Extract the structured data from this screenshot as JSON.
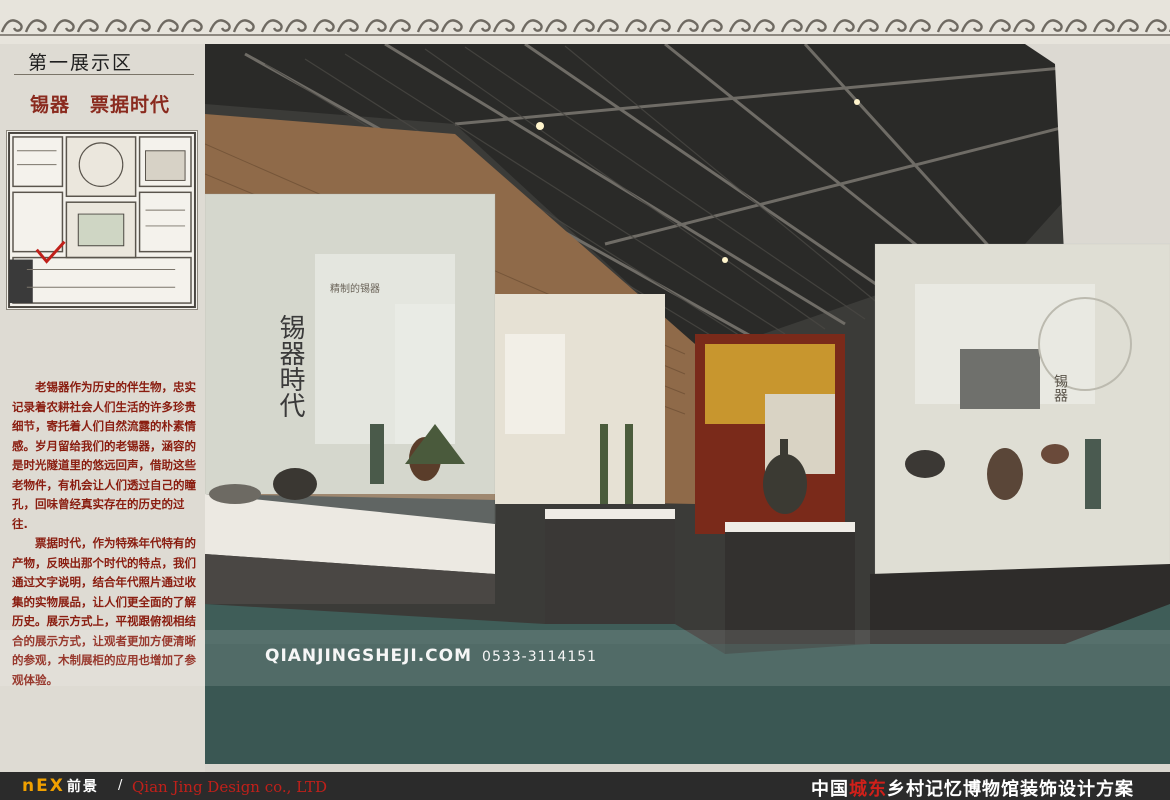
{
  "zone": {
    "title": "第一展示区",
    "subtitle_left": "锡器",
    "subtitle_right": "票据时代"
  },
  "description": {
    "para1": "老锡器作为历史的伴生物，忠实记录着农耕社会人们生活的许多珍贵细节，寄托着人们自然流露的朴素情感。岁月留给我们的老锡器，涵容的是时光隧道里的悠远回声，借助这些老物件，有机会让人们透过自己的瞳孔，回味曾经真实存在的历史的过往.",
    "para2": "票据时代，作为特殊年代特有的产物，反映出那个时代的特点，我们通过文字说明，结合年代照片通过收集的实物展品，让人们更全面的了解历史。展示方式上，平视跟俯视相结合的展示方式，让观者更加方便清晰的参观，木制展柜的应用也增加了参观体验。"
  },
  "watermark": {
    "site": "QIANJINGSHEJI.COM",
    "phone": "0533-3114151"
  },
  "scene": {
    "panel_heading": "精制的锡器",
    "panel_vertical": "锡器時代",
    "right_panel_text": "锡器"
  },
  "footer": {
    "logo": "nEX",
    "logo_cn": "前景",
    "separator": "/",
    "company": "Qian Jing Design co., LTD",
    "project_pre": "中国",
    "project_hl": "城东",
    "project_post": "乡村记忆博物馆装饰设计方案"
  },
  "colors": {
    "accent_red": "#8a1d10",
    "footer_bg": "#2b2b2b",
    "logo_orange": "#f0a000"
  }
}
